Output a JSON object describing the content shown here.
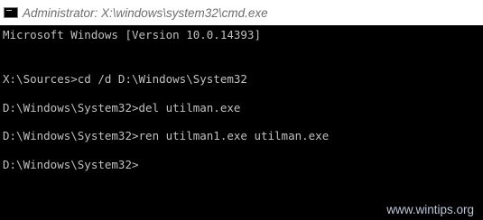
{
  "window": {
    "title": "Administrator: X:\\windows\\system32\\cmd.exe",
    "icon": "cmd-icon"
  },
  "console": {
    "lines": [
      "Microsoft Windows [Version 10.0.14393]",
      "",
      "X:\\Sources>cd /d D:\\Windows\\System32",
      "",
      "D:\\Windows\\System32>del utilman.exe",
      "",
      "D:\\Windows\\System32>ren utilman1.exe utilman.exe",
      "",
      "D:\\Windows\\System32>"
    ]
  },
  "watermark": "www.wintips.org",
  "colors": {
    "console_background": "#000000",
    "console_text": "#c0c0c0",
    "titlebar_background": "#ffffff",
    "titlebar_text": "#6e6e6e"
  }
}
